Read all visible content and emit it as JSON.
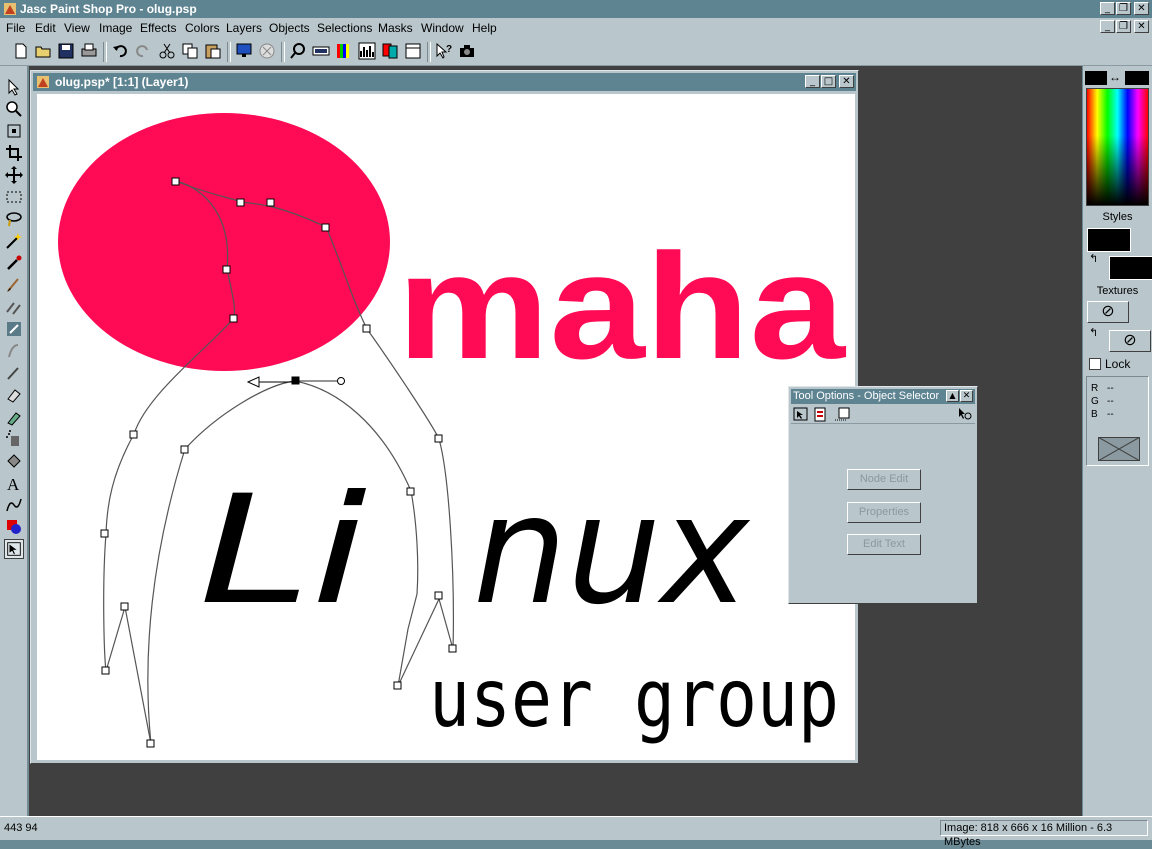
{
  "app": {
    "title": "Jasc Paint Shop Pro - olug.psp"
  },
  "menu": [
    "File",
    "Edit",
    "View",
    "Image",
    "Effects",
    "Colors",
    "Layers",
    "Objects",
    "Selections",
    "Masks",
    "Window",
    "Help"
  ],
  "document": {
    "title": "olug.psp* [1:1] (Layer1)",
    "canvas_text": {
      "omaha": "maha",
      "linux_a": "Li",
      "linux_b": "nux",
      "usergroup": "user group"
    },
    "colors": {
      "accent": "#ff0a55",
      "text": "#000000"
    }
  },
  "palette": {
    "styles_label": "Styles",
    "textures_label": "Textures",
    "lock_label": "Lock",
    "r_label": "R",
    "g_label": "G",
    "b_label": "B",
    "r_value": "--",
    "g_value": "--",
    "b_value": "--"
  },
  "tool_options": {
    "title": "Tool Options - Object Selector",
    "buttons": [
      "Node Edit",
      "Properties",
      "Edit Text"
    ]
  },
  "status": {
    "coords": "443 94",
    "image_info": "Image:  818 x 666 x 16 Million - 6.3 MBytes"
  }
}
